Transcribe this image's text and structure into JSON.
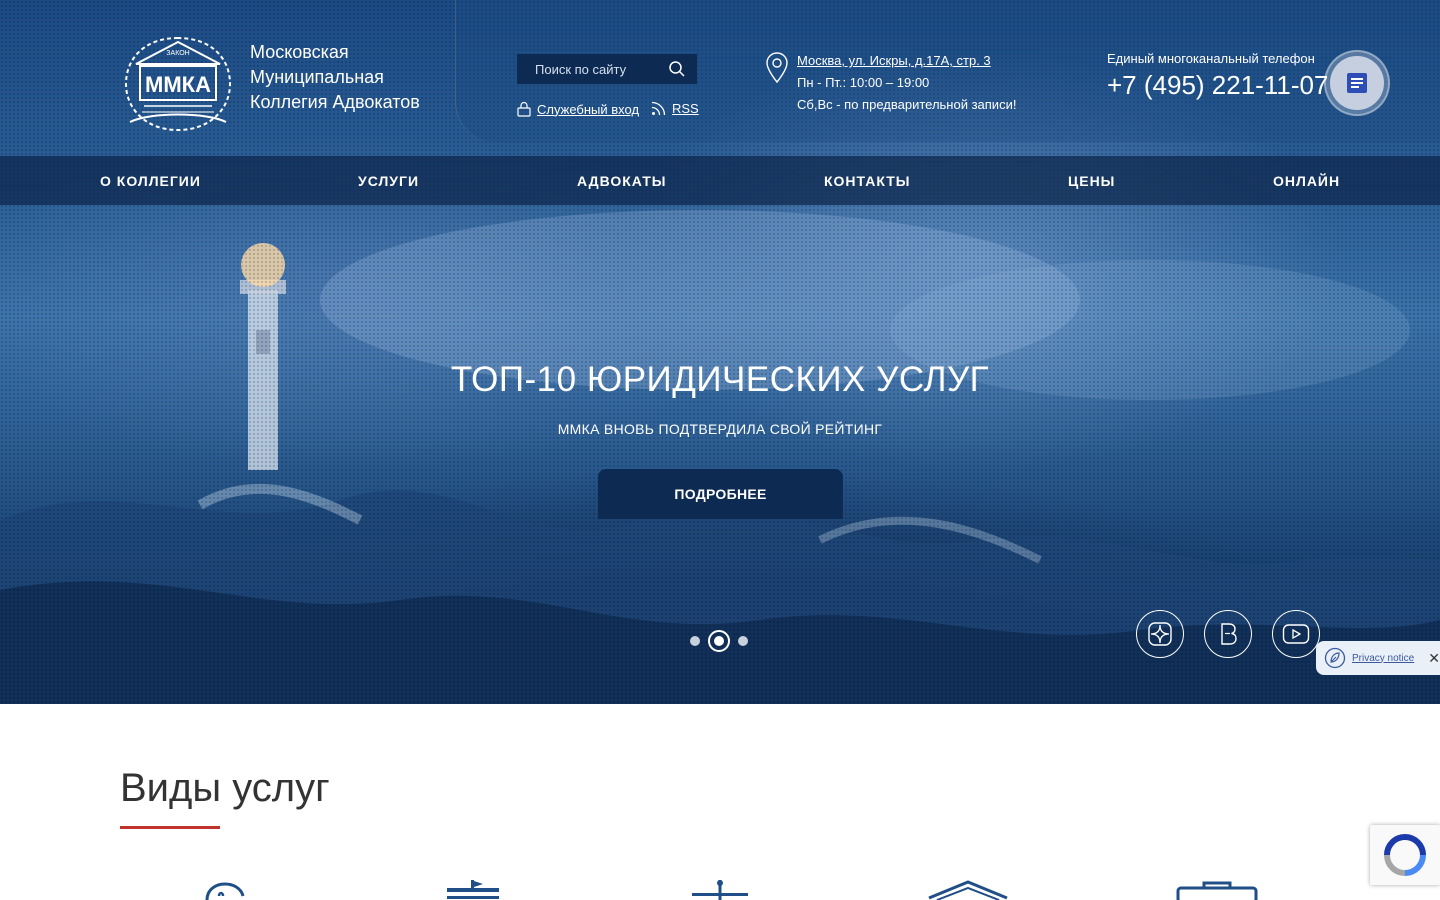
{
  "header": {
    "logo_text_top": "ЗАКОН",
    "logo_text_main": "ММКА",
    "brand_lines": [
      "Московская",
      "Муниципальная",
      "Коллегия Адвокатов"
    ],
    "search_placeholder": "Поиск по сайту",
    "login_label": "Служебный вход",
    "rss_label": "RSS",
    "address": "Москва, ул. Искры, д.17А, стр. 3",
    "hours_weekdays": "Пн - Пт.: 10:00 – 19:00",
    "hours_weekend": "Сб,Вс - по предварительной записи!",
    "phone_label": "Единый многоканальный телефон",
    "phone_number": "+7 (495) 221-11-07"
  },
  "nav": {
    "items": [
      {
        "label": "О КОЛЛЕГИИ"
      },
      {
        "label": "УСЛУГИ"
      },
      {
        "label": "АДВОКАТЫ"
      },
      {
        "label": "КОНТАКТЫ"
      },
      {
        "label": "ЦЕНЫ"
      },
      {
        "label": "ОНЛАЙН"
      }
    ]
  },
  "slider": {
    "title": "ТОП-10 ЮРИДИЧЕСКИХ УСЛУГ",
    "subtitle": "ММКА ВНОВЬ ПОДТВЕРДИЛА СВОЙ РЕЙТИНГ",
    "button_label": "ПОДРОБНЕЕ",
    "slide_count": 3,
    "active_slide": 2
  },
  "social": [
    "zen-icon",
    "vk-icon",
    "youtube-icon"
  ],
  "privacy": {
    "label": "Privacy notice"
  },
  "services": {
    "title": "Виды услуг",
    "icons": [
      "piggy-bank-icon",
      "ship-icon",
      "scales-icon",
      "house-icon",
      "briefcase-icon"
    ]
  },
  "colors": {
    "nav_bg": "#0c2a52",
    "accent_red": "#c2322d",
    "icon_blue": "#1f4f86",
    "heading": "#333333"
  }
}
